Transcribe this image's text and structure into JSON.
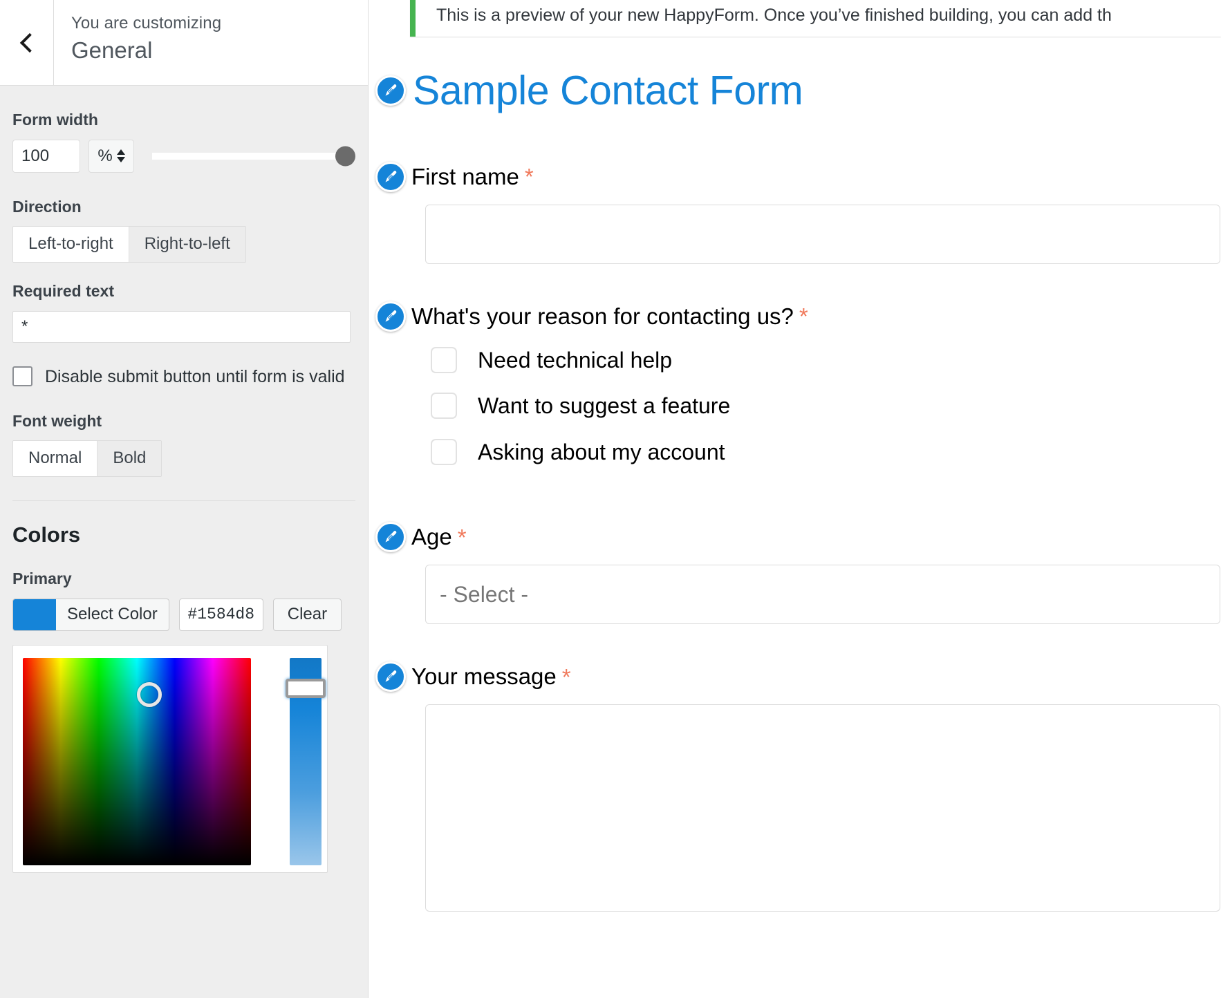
{
  "sidebar": {
    "back_icon": "chevron-left-icon",
    "customizing_label": "You are customizing",
    "panel_title": "General",
    "form_width": {
      "label": "Form width",
      "value": "100",
      "unit": "%",
      "slider_value": 100
    },
    "direction": {
      "label": "Direction",
      "options": [
        "Left-to-right",
        "Right-to-left"
      ],
      "selected": "Left-to-right"
    },
    "required_text": {
      "label": "Required text",
      "value": "*"
    },
    "disable_submit": {
      "label": "Disable submit button until form is valid",
      "checked": false
    },
    "font_weight": {
      "label": "Font weight",
      "options": [
        "Normal",
        "Bold"
      ],
      "selected": "Normal"
    },
    "colors": {
      "section_title": "Colors",
      "primary": {
        "label": "Primary",
        "select_color_label": "Select Color",
        "hex": "#1584d8",
        "clear_label": "Clear",
        "swatch_color": "#1584d8"
      }
    }
  },
  "preview": {
    "notice": "This is a preview of your new HappyForm. Once you’ve finished building, you can add th",
    "notice_accent": "#46b450",
    "form_title": "Sample Contact Form",
    "title_color": "#1584d8",
    "required_marker": "*",
    "required_marker_color": "#f0795b",
    "edit_icon": "pencil-edit-icon",
    "fields": [
      {
        "label": "First name",
        "required": true,
        "type": "text"
      },
      {
        "label": "What's your reason for contacting us?",
        "required": true,
        "type": "checkbox-group",
        "options": [
          "Need technical help",
          "Want to suggest a feature",
          "Asking about my account"
        ]
      },
      {
        "label": "Age",
        "required": true,
        "type": "select",
        "placeholder": "- Select -"
      },
      {
        "label": "Your message",
        "required": true,
        "type": "textarea"
      }
    ]
  }
}
